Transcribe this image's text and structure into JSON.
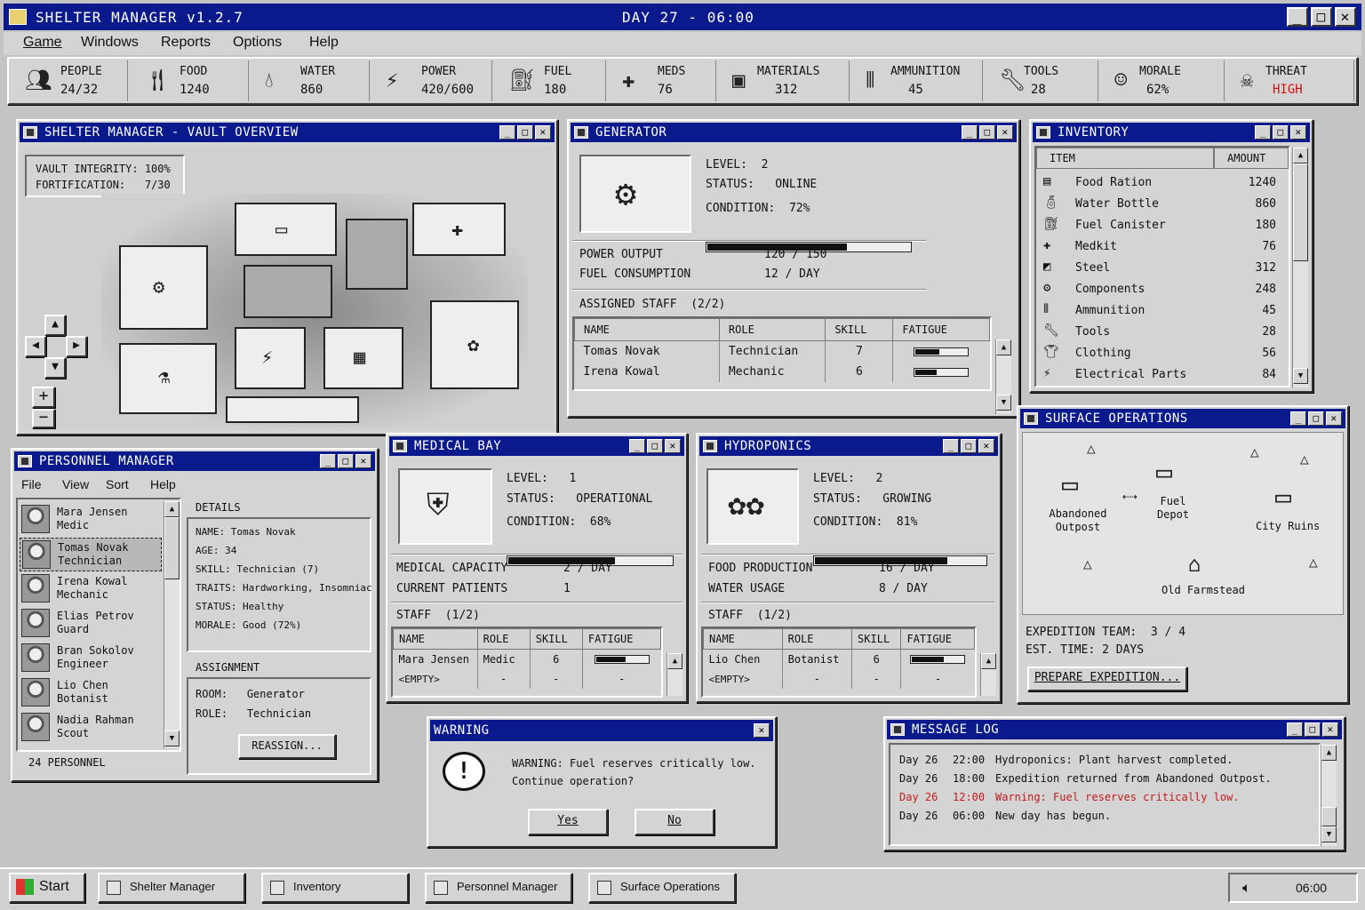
{
  "app": {
    "title": "SHELTER MANAGER v1.2.7",
    "clock": "DAY 27 - 06:00"
  },
  "menu": [
    "Game",
    "Windows",
    "Reports",
    "Options",
    "Help"
  ],
  "resources": [
    {
      "label": "PEOPLE",
      "value": "24/32",
      "icon": "people-icon"
    },
    {
      "label": "FOOD",
      "value": "1240",
      "icon": "fork-knife-icon"
    },
    {
      "label": "WATER",
      "value": "860",
      "icon": "water-drop-icon"
    },
    {
      "label": "POWER",
      "value": "420/600",
      "icon": "lightning-icon"
    },
    {
      "label": "FUEL",
      "value": "180",
      "icon": "fuel-can-icon"
    },
    {
      "label": "MEDS",
      "value": "76",
      "icon": "medical-cross-icon"
    },
    {
      "label": "MATERIALS",
      "value": "312",
      "icon": "crate-icon"
    },
    {
      "label": "AMMUNITION",
      "value": "45",
      "icon": "bullets-icon"
    },
    {
      "label": "TOOLS",
      "value": "28",
      "icon": "wrench-icon"
    },
    {
      "label": "MORALE",
      "value": "62%",
      "icon": "smiley-icon"
    },
    {
      "label": "THREAT",
      "value": "HIGH",
      "icon": "skull-icon"
    }
  ],
  "vault": {
    "title": "SHELTER MANAGER - VAULT OVERVIEW",
    "integrity_label": "VAULT INTEGRITY:",
    "integrity": "100%",
    "fort_label": "FORTIFICATION:",
    "fort": "7/30"
  },
  "generator": {
    "title": "GENERATOR",
    "level_label": "LEVEL:",
    "level": "2",
    "status_label": "STATUS:",
    "status": "ONLINE",
    "condition_label": "CONDITION:",
    "condition": "72%",
    "condition_value": 72,
    "power_label": "POWER OUTPUT",
    "power": "120 / 150",
    "fuel_label": "FUEL CONSUMPTION",
    "fuel": "12 / DAY",
    "staff_label": "ASSIGNED STAFF",
    "staff_count": "(2/2)",
    "cols": [
      "NAME",
      "ROLE",
      "SKILL",
      "FATIGUE"
    ],
    "rows": [
      {
        "name": "Tomas Novak",
        "role": "Technician",
        "skill": "7",
        "fatigue": 45
      },
      {
        "name": "Irena Kowal",
        "role": "Mechanic",
        "skill": "6",
        "fatigue": 40
      }
    ]
  },
  "inventory": {
    "title": "INVENTORY",
    "cols": [
      "ITEM",
      "AMOUNT"
    ],
    "items": [
      {
        "name": "Food Ration",
        "amount": "1240",
        "icon": "food-ration-icon"
      },
      {
        "name": "Water Bottle",
        "amount": "860",
        "icon": "water-bottle-icon"
      },
      {
        "name": "Fuel Canister",
        "amount": "180",
        "icon": "fuel-canister-icon"
      },
      {
        "name": "Medkit",
        "amount": "76",
        "icon": "medkit-icon"
      },
      {
        "name": "Steel",
        "amount": "312",
        "icon": "steel-icon"
      },
      {
        "name": "Components",
        "amount": "248",
        "icon": "components-icon"
      },
      {
        "name": "Ammunition",
        "amount": "45",
        "icon": "ammo-icon"
      },
      {
        "name": "Tools",
        "amount": "28",
        "icon": "tools-icon"
      },
      {
        "name": "Clothing",
        "amount": "56",
        "icon": "clothing-icon"
      },
      {
        "name": "Electrical Parts",
        "amount": "84",
        "icon": "electrical-icon"
      }
    ]
  },
  "surface": {
    "title": "SURFACE OPERATIONS",
    "locations": [
      "Abandoned Outpost",
      "Fuel Depot",
      "City Ruins",
      "Old Farmstead"
    ],
    "team_label": "EXPEDITION TEAM:",
    "team": "3 / 4",
    "time_label": "EST. TIME:",
    "time": "2 DAYS",
    "prepare": "PREPARE EXPEDITION..."
  },
  "personnel": {
    "title": "PERSONNEL MANAGER",
    "menu": [
      "File",
      "View",
      "Sort",
      "Help"
    ],
    "people": [
      {
        "name": "Mara Jensen",
        "role": "Medic"
      },
      {
        "name": "Tomas Novak",
        "role": "Technician"
      },
      {
        "name": "Irena Kowal",
        "role": "Mechanic"
      },
      {
        "name": "Elias Petrov",
        "role": "Guard"
      },
      {
        "name": "Bran Sokolov",
        "role": "Engineer"
      },
      {
        "name": "Lio Chen",
        "role": "Botanist"
      },
      {
        "name": "Nadia Rahman",
        "role": "Scout"
      }
    ],
    "count": "24 PERSONNEL",
    "details_title": "DETAILS",
    "details": [
      {
        "k": "NAME:",
        "v": "Tomas Novak"
      },
      {
        "k": "AGE:",
        "v": "34"
      },
      {
        "k": "SKILL:",
        "v": "Technician (7)"
      },
      {
        "k": "TRAITS:",
        "v": "Hardworking, Insomniac"
      },
      {
        "k": "STATUS:",
        "v": "Healthy"
      },
      {
        "k": "MORALE:",
        "v": "Good (72%)"
      }
    ],
    "assign_title": "ASSIGNMENT",
    "room_label": "ROOM:",
    "room": "Generator",
    "role_label": "ROLE:",
    "role": "Technician",
    "reassign": "REASSIGN..."
  },
  "medical": {
    "title": "MEDICAL BAY",
    "level": "1",
    "status": "OPERATIONAL",
    "condition": "68%",
    "condition_value": 68,
    "cap_label": "MEDICAL CAPACITY",
    "cap": "2 / DAY",
    "pat_label": "CURRENT PATIENTS",
    "pat": "1",
    "staff": "STAFF  (1/2)",
    "rows": [
      {
        "name": "Mara Jensen",
        "role": "Medic",
        "skill": "6",
        "fatigue": 55
      },
      {
        "name": "<EMPTY>",
        "role": "-",
        "skill": "-",
        "fatigue": null
      }
    ]
  },
  "hydro": {
    "title": "HYDROPONICS",
    "level": "2",
    "status": "GROWING",
    "condition": "81%",
    "condition_value": 81,
    "food_label": "FOOD PRODUCTION",
    "food": "16 / DAY",
    "water_label": "WATER USAGE",
    "water": "8 / DAY",
    "staff": "STAFF  (1/2)",
    "rows": [
      {
        "name": "Lio Chen",
        "role": "Botanist",
        "skill": "6",
        "fatigue": 60
      },
      {
        "name": "<EMPTY>",
        "role": "-",
        "skill": "-",
        "fatigue": null
      }
    ]
  },
  "warning": {
    "title": "WARNING",
    "line1": "WARNING: Fuel reserves critically low.",
    "line2": "Continue operation?",
    "yes": "Yes",
    "no": "No"
  },
  "log": {
    "title": "MESSAGE LOG",
    "entries": [
      {
        "day": "Day 26",
        "time": "22:00",
        "msg": "Hydroponics: Plant harvest completed.",
        "alert": false
      },
      {
        "day": "Day 26",
        "time": "18:00",
        "msg": "Expedition returned from Abandoned Outpost.",
        "alert": false
      },
      {
        "day": "Day 26",
        "time": "12:00",
        "msg": "Warning: Fuel reserves critically low.",
        "alert": true
      },
      {
        "day": "Day 26",
        "time": "06:00",
        "msg": "New day has begun.",
        "alert": false
      }
    ]
  },
  "taskbar": {
    "start": "Start",
    "items": [
      "Shelter Manager",
      "Inventory",
      "Personnel Manager",
      "Surface Operations"
    ],
    "clock": "06:00"
  },
  "colors": {
    "titlebar": "#0a1a8c",
    "threat": "#cc1111",
    "alert": "#c41a1a",
    "desktop": "#c4c4c4"
  }
}
